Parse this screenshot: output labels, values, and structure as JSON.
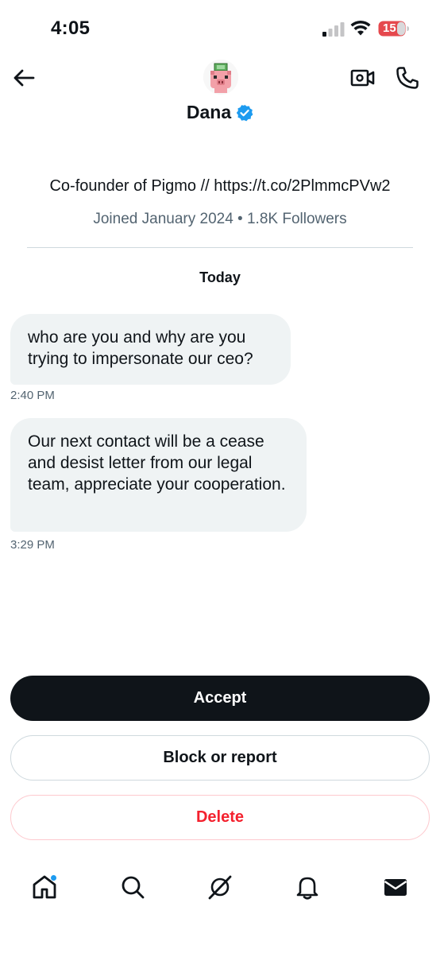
{
  "status_bar": {
    "time": "4:05",
    "battery": "15"
  },
  "header": {
    "name": "Dana",
    "bio": "Co-founder of Pigmo // https://t.co/2PlmmcPVw2",
    "meta": "Joined January 2024 • 1.8K Followers"
  },
  "conversation": {
    "day_label": "Today",
    "messages": [
      {
        "text": "who are you and why are you trying to impersonate our ceo?",
        "time": "2:40 PM"
      },
      {
        "text": "Our next contact will be a cease and desist letter from our legal team, appreciate your cooperation.",
        "time": "3:29 PM"
      }
    ]
  },
  "actions": {
    "accept": "Accept",
    "block_report": "Block or report",
    "delete": "Delete"
  },
  "nav": {
    "items": [
      "home-icon",
      "search-icon",
      "grok-icon",
      "notifications-icon",
      "messages-icon"
    ]
  },
  "colors": {
    "accent": "#1d9bf0",
    "danger": "#f4212e",
    "bubble": "#eff3f4",
    "battery_red": "#e5484d"
  }
}
